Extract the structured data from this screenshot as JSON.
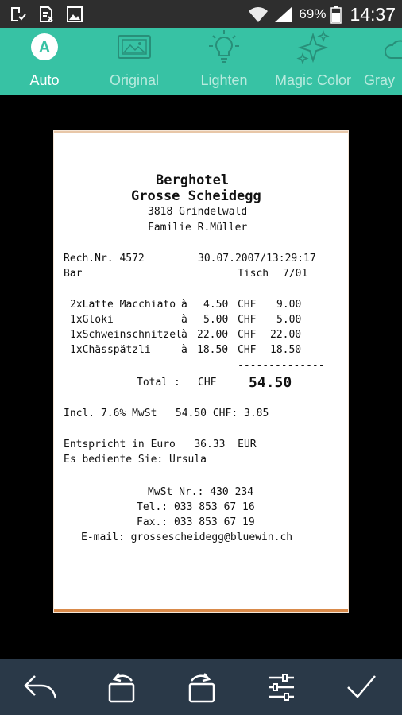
{
  "status_bar": {
    "battery_percent": "69%",
    "time": "14:37",
    "icons": [
      "download-done-icon",
      "sim-card-icon",
      "image-icon",
      "wifi-icon",
      "signal-icon",
      "battery-icon"
    ]
  },
  "filter_tabs": [
    {
      "label": "Auto",
      "icon": "auto-a-icon",
      "selected": true
    },
    {
      "label": "Original",
      "icon": "image-icon",
      "selected": false
    },
    {
      "label": "Lighten",
      "icon": "lightbulb-icon",
      "selected": false
    },
    {
      "label": "Magic Color",
      "icon": "sparkles-icon",
      "selected": false
    },
    {
      "label": "Gray",
      "icon": "cloud-icon",
      "selected": false
    }
  ],
  "auto_icon_letter": "A",
  "receipt": {
    "header": [
      "Berghotel",
      "Grosse Scheidegg",
      "3818 Grindelwald",
      "Familie R.Müller"
    ],
    "rech_nr": "Rech.Nr. 4572",
    "datetime": "30.07.2007/13:29:17",
    "bar": "Bar",
    "tisch": "Tisch",
    "tisch_no": "7/01",
    "items": [
      {
        "name": "2xLatte Macchiato",
        "at": "à",
        "price": "4.50",
        "cur": "CHF",
        "total": "9.00"
      },
      {
        "name": "1xGloki",
        "at": "à",
        "price": "5.00",
        "cur": "CHF",
        "total": "5.00"
      },
      {
        "name": "1xSchweinschnitzel",
        "at": "à",
        "price": "22.00",
        "cur": "CHF",
        "total": "22.00"
      },
      {
        "name": "1xChässpätzli",
        "at": "à",
        "price": "18.50",
        "cur": "CHF",
        "total": "18.50"
      }
    ],
    "separator": "--------------",
    "total_label": "Total :",
    "total_cur": "CHF",
    "total_value": "54.50",
    "mwst_line": "Incl. 7.6% MwSt   54.50 CHF:",
    "mwst_value": "3.85",
    "euro_line": "Entspricht in Euro   36.33  EUR",
    "server_line": "Es bediente Sie: Ursula",
    "footer": [
      "MwSt Nr.: 430 234",
      "Tel.: 033 853 67 16",
      "Fax.: 033 853 67 19",
      "E-mail: grossescheidegg@bluewin.ch"
    ]
  },
  "bottom_actions": [
    "back-arrow-icon",
    "rotate-left-icon",
    "rotate-right-icon",
    "adjust-sliders-icon",
    "confirm-check-icon"
  ],
  "colors": {
    "toolbar": "#37c2a4",
    "status_bar": "#2e2e2e",
    "bottom_bar": "#2a3948"
  }
}
